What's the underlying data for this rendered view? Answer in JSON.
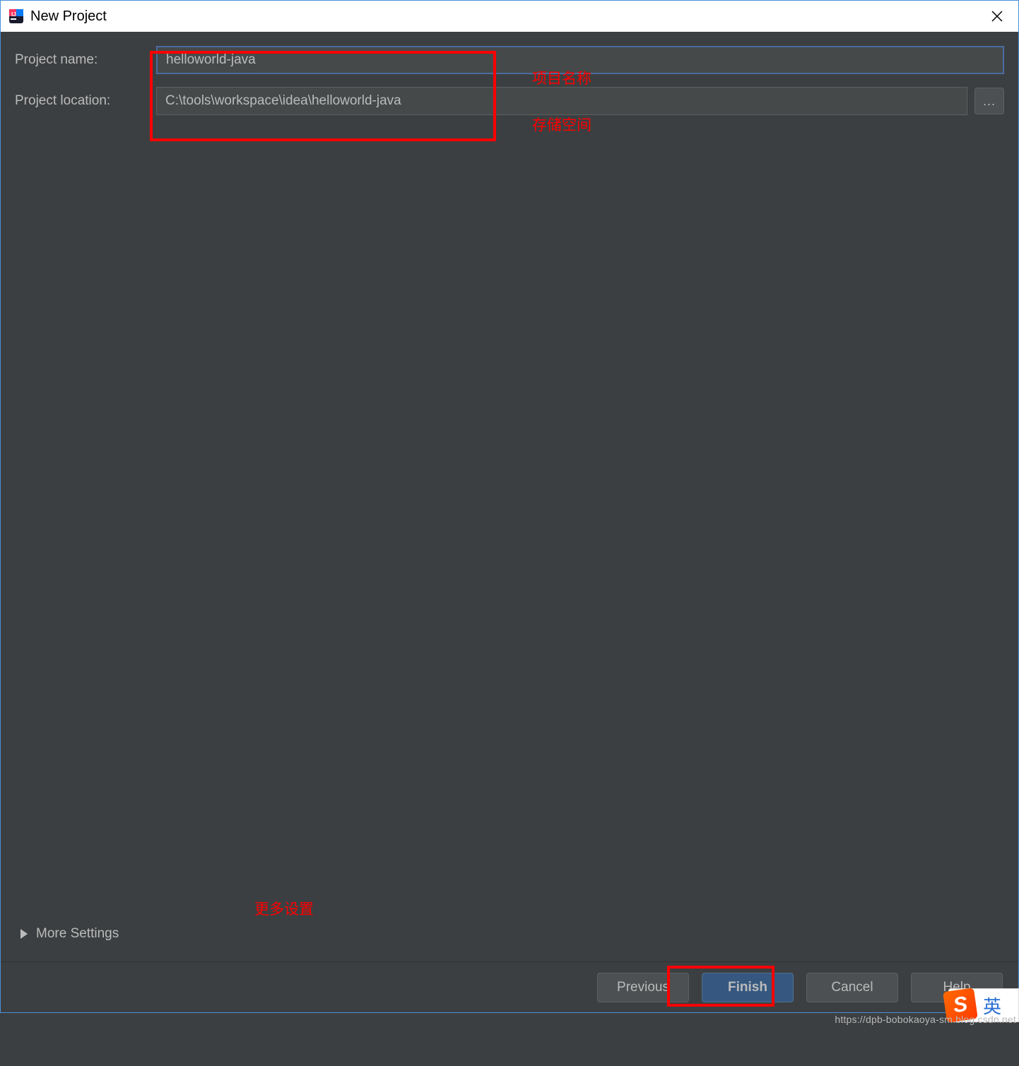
{
  "window": {
    "title": "New Project"
  },
  "form": {
    "project_name_label": "Project name:",
    "project_name_value": "helloworld-java",
    "project_location_label": "Project location:",
    "project_location_value": "C:\\tools\\workspace\\idea\\helloworld-java",
    "browse_label": "..."
  },
  "annotations": {
    "project_name": "项目名称",
    "project_location": "存储空间",
    "more_settings": "更多设置"
  },
  "more_settings_label": "More Settings",
  "buttons": {
    "previous": "Previous",
    "finish": "Finish",
    "cancel": "Cancel",
    "help": "Help"
  },
  "ime": {
    "badge": "S",
    "lang": "英"
  },
  "watermark": "https://dpb-bobokaoya-sm.blog.csdn.net"
}
